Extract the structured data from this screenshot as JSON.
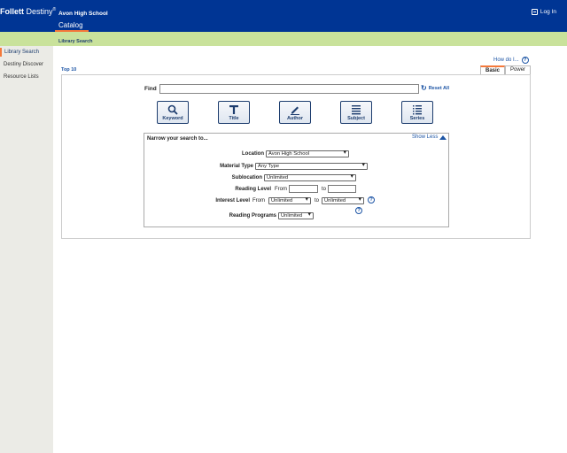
{
  "header": {
    "logo_brand": "Follett",
    "logo_product": "Destiny",
    "logo_mark": "®",
    "school": "Avon High School",
    "active_tab": "Catalog",
    "login_label": "Log In"
  },
  "subheader": {
    "label": "Library Search"
  },
  "sidebar": {
    "items": [
      {
        "label": "Library Search",
        "active": true
      },
      {
        "label": "Destiny Discover",
        "active": false
      },
      {
        "label": "Resource Lists",
        "active": false
      }
    ]
  },
  "help": {
    "how_do_i": "How do I...",
    "icon": "?"
  },
  "top10": "Top 10",
  "modes": {
    "basic": "Basic",
    "power": "Power"
  },
  "search": {
    "find_label": "Find",
    "find_value": "",
    "reset_label": "Reset All",
    "buttons": [
      {
        "label": "Keyword",
        "icon": "magnifier-icon"
      },
      {
        "label": "Title",
        "icon": "title-T-icon"
      },
      {
        "label": "Author",
        "icon": "pen-icon"
      },
      {
        "label": "Subject",
        "icon": "lines-icon"
      },
      {
        "label": "Series",
        "icon": "numbered-list-icon"
      }
    ]
  },
  "narrow": {
    "title": "Narrow your search to...",
    "show_less": "Show Less",
    "location_label": "Location",
    "location_value": "Avon High School",
    "material_label": "Material Type",
    "material_value": "Any Type",
    "sublocation_label": "Sublocation",
    "sublocation_value": "Unlimited",
    "reading_level_label": "Reading Level",
    "from_label": "From",
    "to_label": "to",
    "reading_from": "",
    "reading_to": "",
    "interest_level_label": "Interest Level",
    "interest_from": "Unlimited",
    "interest_to": "Unlimited",
    "reading_programs_label": "Reading Programs",
    "reading_programs_value": "Unlimited"
  },
  "colors": {
    "brand_blue": "#003594",
    "accent_orange": "#f4793b",
    "subbar_green": "#c9e29b",
    "link_blue": "#1d55a5"
  }
}
